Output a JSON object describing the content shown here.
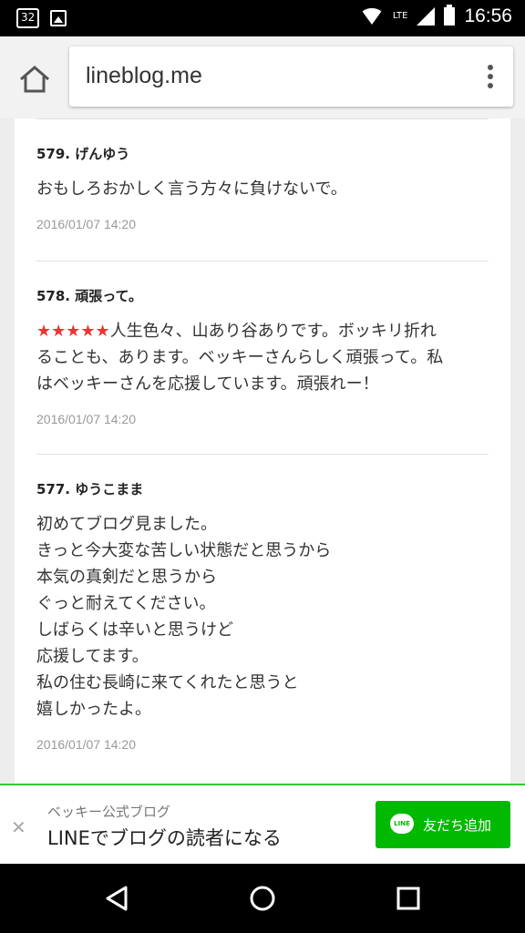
{
  "status_bar": {
    "notification_badge": "32",
    "network_type": "LTE",
    "time": "16:56"
  },
  "browser": {
    "url": "lineblog.me"
  },
  "comments": [
    {
      "number": "579.",
      "name": "げんゆう",
      "body_lines": [
        "おもしろおかしく言う方々に負けないで。"
      ],
      "date": "2016/01/07 14:20"
    },
    {
      "number": "578.",
      "name": "頑張って。",
      "stars": "★★★★★",
      "body_lines": [
        "人生色々、山あり谷ありです。ボッキリ折れ",
        "ることも、あります。ベッキーさんらしく頑張って。私",
        "はベッキーさんを応援しています。頑張れー！"
      ],
      "date": "2016/01/07 14:20"
    },
    {
      "number": "577.",
      "name": "ゆうこまま",
      "body_lines": [
        "初めてブログ見ました。",
        "きっと今大変な苦しい状態だと思うから",
        "本気の真剣だと思うから",
        "ぐっと耐えてください。",
        "しばらくは辛いと思うけど",
        "応援してます。",
        "私の住む長崎に来てくれたと思うと",
        "嬉しかったよ。"
      ],
      "date": "2016/01/07 14:20"
    }
  ],
  "banner": {
    "subtitle": "ベッキー公式ブログ",
    "title": "LINEでブログの読者になる",
    "icon_text": "LINE",
    "button_label": "友だち追加",
    "accent_color": "#00b900"
  }
}
